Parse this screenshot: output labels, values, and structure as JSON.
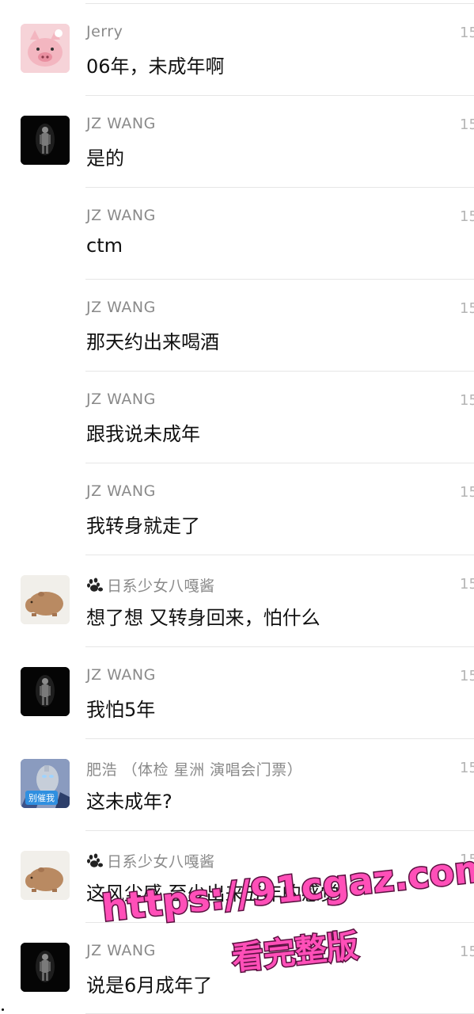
{
  "messages": [
    {
      "sender": "Jerry",
      "text": "06年，未成年啊",
      "time": "15",
      "avatar": "pig-avatar"
    },
    {
      "sender": "JZ WANG",
      "text": "是的",
      "time": "15",
      "avatar": "dark-figure-avatar"
    },
    {
      "sender": "JZ WANG",
      "text": "ctm",
      "time": "15",
      "avatar": ""
    },
    {
      "sender": "JZ WANG",
      "text": "那天约出来喝酒",
      "time": "15",
      "avatar": ""
    },
    {
      "sender": "JZ WANG",
      "text": "跟我说未成年",
      "time": "15",
      "avatar": ""
    },
    {
      "sender": "JZ WANG",
      "text": "我转身就走了",
      "time": "15",
      "avatar": ""
    },
    {
      "sender": "日系少女八嘎酱",
      "text": "想了想 又转身回来，怕什么",
      "time": "15",
      "avatar": "capybara-avatar",
      "sender_icon": "paw-icon"
    },
    {
      "sender": "JZ WANG",
      "text": "我怕5年",
      "time": "15",
      "avatar": "dark-figure-avatar"
    },
    {
      "sender": "肥浩 （体检 星洲 演唱会门票）",
      "text": "这未成年?",
      "time": "15",
      "avatar": "hero-avatar",
      "avatar_badge": "别催我"
    },
    {
      "sender": "日系少女八嘎酱",
      "text": "这风尘感 至少出来五年的感觉",
      "time": "15",
      "avatar": "capybara-avatar",
      "sender_icon": "paw-icon"
    },
    {
      "sender": "JZ WANG",
      "text": "说是6月成年了",
      "time": "15",
      "avatar": "dark-figure-avatar"
    }
  ],
  "watermark": {
    "url": "https://91cgaz.com",
    "subtitle": "看完整版"
  },
  "colors": {
    "name": "#8a8a8a",
    "text": "#111111",
    "separator": "#e6e6e6",
    "watermark": "#ff4fb8",
    "badge": "#2f8fe0"
  }
}
